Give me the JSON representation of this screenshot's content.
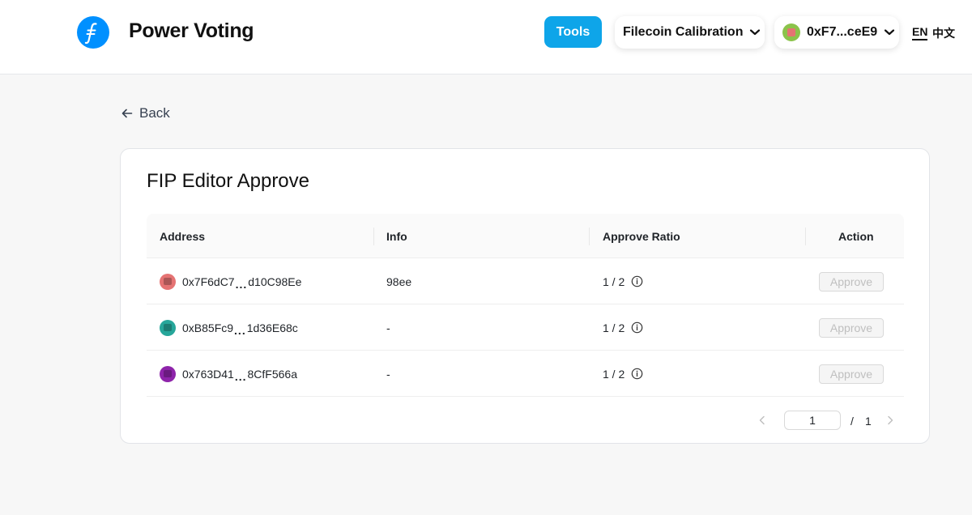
{
  "header": {
    "app_title": "Power Voting",
    "tools_label": "Tools",
    "network_label": "Filecoin Calibration",
    "account_label": "0xF7...ceE9",
    "lang_en": "EN",
    "lang_zh": "中文"
  },
  "nav": {
    "back_label": "Back"
  },
  "card": {
    "title": "FIP Editor Approve",
    "columns": [
      "Address",
      "Info",
      "Approve Ratio",
      "Action"
    ],
    "rows": [
      {
        "addr_pre": "0x7F6dC7",
        "addr_post": "d10C98Ee",
        "info": "98ee",
        "ratio": "1 / 2",
        "action": "Approve",
        "avatar_color": "#e57373"
      },
      {
        "addr_pre": "0xB85Fc9",
        "addr_post": "1d36E68c",
        "info": "-",
        "ratio": "1 / 2",
        "action": "Approve",
        "avatar_color": "#26a69a"
      },
      {
        "addr_pre": "0x763D41",
        "addr_post": "8CfF566a",
        "info": "-",
        "ratio": "1 / 2",
        "action": "Approve",
        "avatar_color": "#8e24aa"
      }
    ],
    "pagination": {
      "current_page": "1",
      "slash": "/",
      "total_pages": "1"
    }
  },
  "colors": {
    "brand": "#0090ff",
    "tools_button": "#0ea5e9"
  }
}
